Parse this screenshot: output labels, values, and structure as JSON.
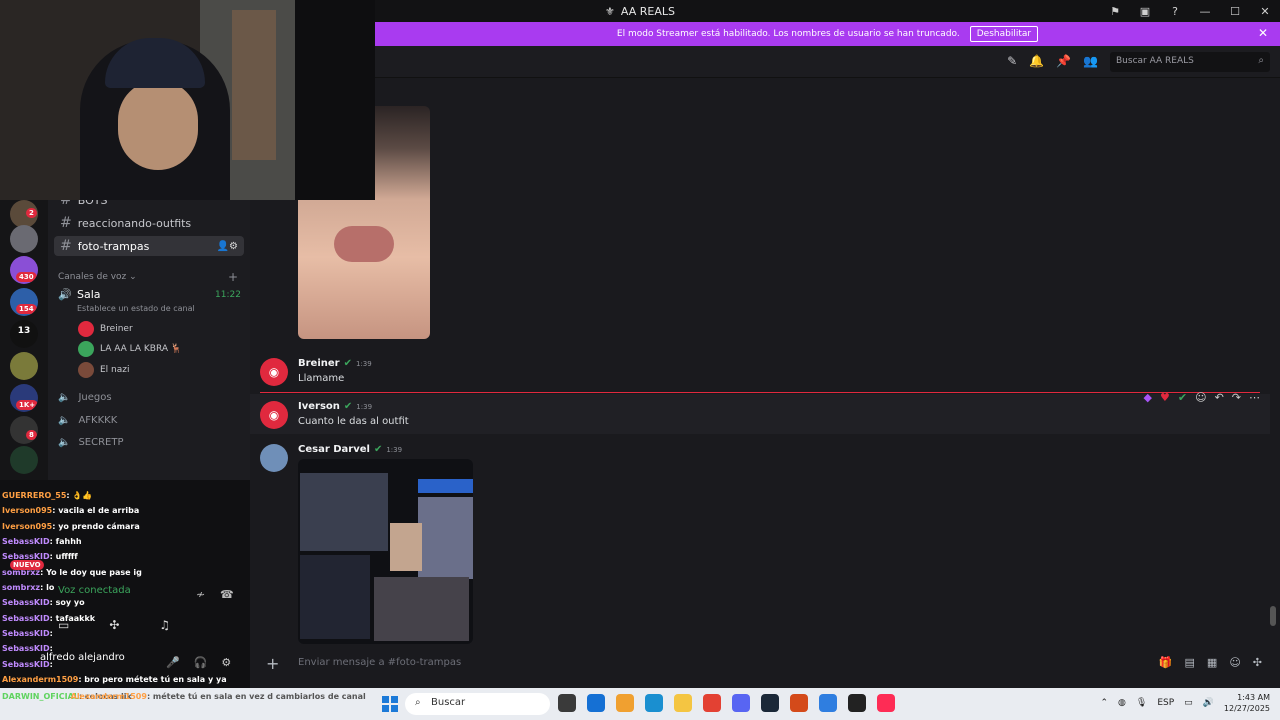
{
  "window": {
    "title": "AA REALS"
  },
  "banner": {
    "text": "El modo Streamer está habilitado. Los nombres de usuario se han truncado.",
    "button": "Deshabilitar"
  },
  "header": {
    "search_placeholder": "Buscar AA REALS"
  },
  "servers": {
    "badges": [
      "2",
      "430",
      "154",
      "1K+",
      "8"
    ],
    "label_13": "13"
  },
  "channels": {
    "text": [
      {
        "name": "BOTS"
      },
      {
        "name": "reaccionando-outfits"
      },
      {
        "name": "foto-trampas"
      }
    ],
    "voice_section": "Canales de voz",
    "sala": {
      "name": "Sala",
      "time": "11:22",
      "status": "Establece un estado de canal"
    },
    "voice_users": [
      "Breiner",
      "LA AA LA KBRA 🦌",
      "El nazi"
    ],
    "voice_channels": [
      "Juegos",
      "AFKKKK",
      "SECRETP"
    ]
  },
  "voice_panel": {
    "status": "Voz conectada",
    "badge": "NUEVO"
  },
  "user": {
    "name": "alfredo alejandro"
  },
  "stream_chat": [
    {
      "user": "GUERRERO_55",
      "text": ": 👌👍"
    },
    {
      "user": "Iverson095",
      "text": ": vacila el de arriba"
    },
    {
      "user": "Iverson095",
      "text": ": yo prendo cámara"
    },
    {
      "user": "SebassKID",
      "text": ": fahhh"
    },
    {
      "user": "SebassKID",
      "text": ": ufffff"
    },
    {
      "user": "sombrxz",
      "text": ": Yo le doy que pase ig"
    },
    {
      "user": "sombrxz",
      "text": ": lo"
    },
    {
      "user": "SebassKID",
      "text": ": soy yo"
    },
    {
      "user": "SebassKID",
      "text": ": tafaakkk"
    },
    {
      "user": "SebassKID",
      "text": ":"
    },
    {
      "user": "SebassKID",
      "text": ":"
    },
    {
      "user": "SebassKID",
      "text": ":"
    },
    {
      "user": "Alexanderm1509",
      "text": ": bro pero métete tú en sala y ya"
    },
    {
      "user": "DARWIN_OFICIAL",
      "text": ": colocas lik"
    },
    {
      "user": "Alexanderm1509",
      "text": ": métete tú en sala en vez d cambiarlos de canal"
    }
  ],
  "messages": [
    {
      "author": "Breiner",
      "time": "1:39",
      "text": "Llamame"
    },
    {
      "author": "Iverson",
      "time": "1:39",
      "text": "Cuanto le das al outfit"
    },
    {
      "author": "Cesar Darvel",
      "time": "1:39",
      "text": ""
    }
  ],
  "composer": {
    "placeholder": "Enviar mensaje a #foto-trampas"
  },
  "taskbar": {
    "search": "Buscar",
    "lang": "ESP",
    "time": "1:43 AM",
    "date": "12/27/2025"
  }
}
